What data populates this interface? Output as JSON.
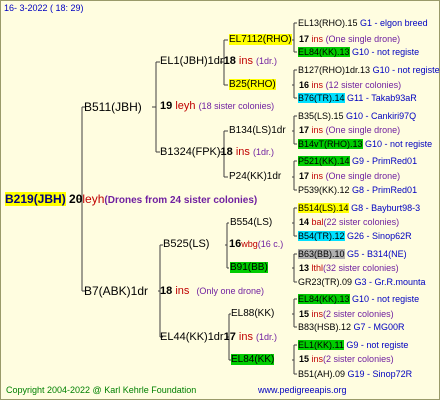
{
  "header": {
    "date": "16-  3-2022 (  18:  29)"
  },
  "footer": {
    "copyright": "Copyright 2004-2022 @ Karl Kehrle Foundation",
    "site": "www.pedigreeapis.org"
  },
  "root": {
    "id": "B219(JBH)",
    "num": "20",
    "name": "leyh",
    "note": "(Drones from 24 sister colonies)"
  },
  "gen1": [
    {
      "id": "B511(JBH)",
      "num": "19",
      "name": "leyh",
      "note": "(18 sister colonies)"
    },
    {
      "id": "B7(ABK)1dr",
      "num": "18",
      "name": "ins",
      "note": "(Only one drone)"
    }
  ],
  "gen2": [
    {
      "id": "EL1(JBH)1dr",
      "num": "18",
      "name": "ins",
      "note": "(1dr.)"
    },
    {
      "id": "B1324(FPK)",
      "num": "18",
      "name": "ins",
      "note": "(1dr.)"
    },
    {
      "id": "B525(LS)",
      "num": "16",
      "name": "wbg",
      "note": "(16 c.)"
    },
    {
      "id": "EL44(KK)1dr",
      "num": "17",
      "name": "ins",
      "note": "(1dr.)"
    }
  ],
  "gen3": [
    {
      "id": "EL7112(RHO)",
      "num": "17",
      "name": "ins",
      "note": "(One single drone)"
    },
    {
      "id": "B25(RHO)",
      "num": "16",
      "name": "ins",
      "note": "(12 sister colonies)"
    },
    {
      "id": "B134(LS)1dr",
      "num": "17",
      "name": "ins",
      "note": "(One single drone)"
    },
    {
      "id": "P24(KK)1dr",
      "num": "17",
      "name": "ins",
      "note": "(One single drone)"
    },
    {
      "id": "B554(LS)",
      "num": "14",
      "name": "bal",
      "note": "(22 sister colonies)"
    },
    {
      "id": "B91(BB)",
      "num": "13",
      "name": "lthl",
      "note": "(32 sister colonies)"
    },
    {
      "id": "EL88(KK)",
      "num": "15",
      "name": "ins",
      "note": "(2 sister colonies)"
    },
    {
      "id": "EL84(KK)",
      "num": "15",
      "name": "ins",
      "note": "(2 sister colonies)"
    }
  ],
  "gen4": [
    {
      "text": "EL13(RHO).15",
      "code": "G1 - elgon breed"
    },
    {
      "text": "EL84(KK).13",
      "code": "G10 - not registe"
    },
    {
      "text": "B127(RHO)1dr.13",
      "code": "G10 - not registe"
    },
    {
      "text": "B76(TR).14",
      "code": "G11 - Takab93aR"
    },
    {
      "text": "B35(LS).15",
      "code": "G10 - Cankiri97Q"
    },
    {
      "text": "B14vT(RHO).13",
      "code": "G10 - not registe"
    },
    {
      "text": "P521(KK).14",
      "code": "G9 - PrimRed01"
    },
    {
      "text": "P539(KK).12",
      "code": "G8 - PrimRed01"
    },
    {
      "text": "B514(LS).14",
      "code": "G8 - Bayburt98-3"
    },
    {
      "text": "B54(TR).12",
      "code": "G26 - Sinop62R"
    },
    {
      "text": "B63(BB).10",
      "code": "G5 - B314(NE)"
    },
    {
      "text": "GR23(TR).09",
      "code": "G3 - Gr.R.mounta"
    },
    {
      "text": "EL84(KK).13",
      "code": "G10 - not registe"
    },
    {
      "text": "B83(HSB).12",
      "code": "G7 - MG00R"
    },
    {
      "text": "EL1(KK).11",
      "code": "G9 - not registe"
    },
    {
      "text": "B51(AH).09",
      "code": "G19 - Sinop72R"
    }
  ],
  "colors": {
    "background": "#fffde0",
    "highlight_yellow": "#ffff00",
    "highlight_green": "#00cc00",
    "highlight_cyan": "#00e0ff",
    "highlight_gray": "#b0b0b0"
  }
}
